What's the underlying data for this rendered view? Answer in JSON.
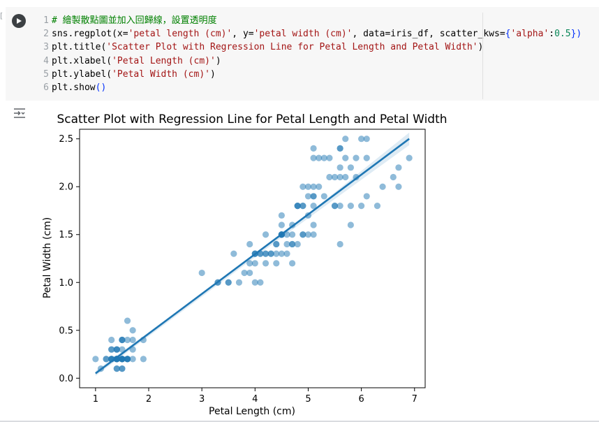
{
  "notebook": {
    "cell": {
      "lines": [
        {
          "num": "1",
          "parts": [
            {
              "t": "# 繪製散點圖並加入回歸線，設置透明度",
              "c": "c-com"
            }
          ]
        },
        {
          "num": "2",
          "parts": [
            {
              "t": "sns.regplot(x=",
              "c": "c-def"
            },
            {
              "t": "'petal length (cm)'",
              "c": "c-str"
            },
            {
              "t": ", y=",
              "c": "c-def"
            },
            {
              "t": "'petal width (cm)'",
              "c": "c-str"
            },
            {
              "t": ", data=iris_df, scatter_kws=",
              "c": "c-def"
            },
            {
              "t": "{",
              "c": "c-punc"
            },
            {
              "t": "'alpha'",
              "c": "c-str"
            },
            {
              "t": ":",
              "c": "c-def"
            },
            {
              "t": "0.5",
              "c": "c-num"
            },
            {
              "t": "})",
              "c": "c-punc"
            }
          ]
        },
        {
          "num": "3",
          "parts": [
            {
              "t": "plt.title(",
              "c": "c-def"
            },
            {
              "t": "'Scatter Plot with Regression Line for Petal Length and Petal Width'",
              "c": "c-str"
            },
            {
              "t": ")",
              "c": "c-def"
            }
          ]
        },
        {
          "num": "4",
          "parts": [
            {
              "t": "plt.xlabel(",
              "c": "c-def"
            },
            {
              "t": "'Petal Length (cm)'",
              "c": "c-str"
            },
            {
              "t": ")",
              "c": "c-def"
            }
          ]
        },
        {
          "num": "5",
          "parts": [
            {
              "t": "plt.ylabel(",
              "c": "c-def"
            },
            {
              "t": "'Petal Width (cm)'",
              "c": "c-str"
            },
            {
              "t": ")",
              "c": "c-def"
            }
          ]
        },
        {
          "num": "6",
          "parts": [
            {
              "t": "plt.show",
              "c": "c-def"
            },
            {
              "t": "()",
              "c": "c-punc"
            }
          ]
        }
      ]
    },
    "icons": {
      "run": "play-icon",
      "output": "output-toggle-icon"
    }
  },
  "chart_data": {
    "type": "scatter",
    "title": "Scatter Plot with Regression Line for Petal Length and Petal Width",
    "xlabel": "Petal Length (cm)",
    "ylabel": "Petal Width (cm)",
    "xlim": [
      0.7,
      7.2
    ],
    "ylim": [
      -0.1,
      2.6
    ],
    "xticks": [
      "1",
      "2",
      "3",
      "4",
      "5",
      "6",
      "7"
    ],
    "yticks": [
      "0.0",
      "0.5",
      "1.0",
      "1.5",
      "2.0",
      "2.5"
    ],
    "grid": false,
    "point_color": "#1f77b4",
    "point_alpha": 0.5,
    "regression": {
      "x": [
        1.0,
        6.9
      ],
      "y": [
        0.05,
        2.5
      ],
      "color": "#1f77b4"
    },
    "points": [
      [
        1.4,
        0.2
      ],
      [
        1.4,
        0.2
      ],
      [
        1.3,
        0.2
      ],
      [
        1.5,
        0.2
      ],
      [
        1.4,
        0.2
      ],
      [
        1.7,
        0.4
      ],
      [
        1.4,
        0.3
      ],
      [
        1.5,
        0.2
      ],
      [
        1.4,
        0.2
      ],
      [
        1.5,
        0.1
      ],
      [
        1.5,
        0.2
      ],
      [
        1.6,
        0.2
      ],
      [
        1.4,
        0.1
      ],
      [
        1.1,
        0.1
      ],
      [
        1.2,
        0.2
      ],
      [
        1.5,
        0.4
      ],
      [
        1.3,
        0.4
      ],
      [
        1.4,
        0.3
      ],
      [
        1.7,
        0.3
      ],
      [
        1.5,
        0.3
      ],
      [
        1.7,
        0.2
      ],
      [
        1.5,
        0.4
      ],
      [
        1.0,
        0.2
      ],
      [
        1.7,
        0.5
      ],
      [
        1.9,
        0.2
      ],
      [
        1.6,
        0.2
      ],
      [
        1.6,
        0.4
      ],
      [
        1.5,
        0.2
      ],
      [
        1.4,
        0.2
      ],
      [
        1.6,
        0.2
      ],
      [
        1.6,
        0.2
      ],
      [
        1.5,
        0.4
      ],
      [
        1.5,
        0.1
      ],
      [
        1.4,
        0.2
      ],
      [
        1.5,
        0.2
      ],
      [
        1.2,
        0.2
      ],
      [
        1.3,
        0.2
      ],
      [
        1.4,
        0.1
      ],
      [
        1.3,
        0.2
      ],
      [
        1.5,
        0.2
      ],
      [
        1.3,
        0.3
      ],
      [
        1.3,
        0.3
      ],
      [
        1.3,
        0.2
      ],
      [
        1.6,
        0.6
      ],
      [
        1.9,
        0.4
      ],
      [
        1.4,
        0.3
      ],
      [
        1.6,
        0.2
      ],
      [
        1.4,
        0.2
      ],
      [
        1.5,
        0.2
      ],
      [
        1.4,
        0.2
      ],
      [
        4.7,
        1.4
      ],
      [
        4.5,
        1.5
      ],
      [
        4.9,
        1.5
      ],
      [
        4.0,
        1.3
      ],
      [
        4.6,
        1.5
      ],
      [
        4.5,
        1.3
      ],
      [
        4.7,
        1.6
      ],
      [
        3.3,
        1.0
      ],
      [
        4.6,
        1.3
      ],
      [
        3.9,
        1.4
      ],
      [
        3.5,
        1.0
      ],
      [
        4.2,
        1.5
      ],
      [
        4.0,
        1.0
      ],
      [
        4.7,
        1.4
      ],
      [
        3.6,
        1.3
      ],
      [
        4.4,
        1.4
      ],
      [
        4.5,
        1.5
      ],
      [
        4.1,
        1.0
      ],
      [
        4.5,
        1.5
      ],
      [
        3.9,
        1.1
      ],
      [
        4.8,
        1.8
      ],
      [
        4.0,
        1.3
      ],
      [
        4.9,
        1.5
      ],
      [
        4.7,
        1.2
      ],
      [
        4.3,
        1.3
      ],
      [
        4.4,
        1.4
      ],
      [
        4.8,
        1.4
      ],
      [
        5.0,
        1.7
      ],
      [
        4.5,
        1.5
      ],
      [
        3.5,
        1.0
      ],
      [
        3.8,
        1.1
      ],
      [
        3.7,
        1.0
      ],
      [
        3.9,
        1.2
      ],
      [
        5.1,
        1.6
      ],
      [
        4.5,
        1.5
      ],
      [
        4.5,
        1.6
      ],
      [
        4.7,
        1.5
      ],
      [
        4.4,
        1.3
      ],
      [
        4.1,
        1.3
      ],
      [
        4.0,
        1.3
      ],
      [
        4.4,
        1.2
      ],
      [
        4.6,
        1.4
      ],
      [
        4.0,
        1.2
      ],
      [
        3.3,
        1.0
      ],
      [
        4.2,
        1.3
      ],
      [
        4.2,
        1.2
      ],
      [
        4.2,
        1.3
      ],
      [
        4.3,
        1.3
      ],
      [
        3.0,
        1.1
      ],
      [
        4.1,
        1.3
      ],
      [
        6.0,
        2.5
      ],
      [
        5.1,
        1.9
      ],
      [
        5.9,
        2.1
      ],
      [
        5.6,
        1.8
      ],
      [
        5.8,
        2.2
      ],
      [
        6.6,
        2.1
      ],
      [
        4.5,
        1.7
      ],
      [
        6.3,
        1.8
      ],
      [
        5.8,
        1.8
      ],
      [
        6.1,
        2.5
      ],
      [
        5.1,
        2.0
      ],
      [
        5.3,
        1.9
      ],
      [
        5.5,
        2.1
      ],
      [
        5.0,
        2.0
      ],
      [
        5.1,
        2.4
      ],
      [
        5.3,
        2.3
      ],
      [
        5.5,
        1.8
      ],
      [
        6.7,
        2.2
      ],
      [
        6.9,
        2.3
      ],
      [
        5.0,
        1.5
      ],
      [
        5.7,
        2.3
      ],
      [
        4.9,
        2.0
      ],
      [
        6.7,
        2.0
      ],
      [
        4.9,
        1.8
      ],
      [
        5.7,
        2.1
      ],
      [
        6.0,
        1.8
      ],
      [
        4.8,
        1.8
      ],
      [
        4.9,
        1.8
      ],
      [
        5.6,
        2.1
      ],
      [
        5.8,
        1.6
      ],
      [
        6.1,
        1.9
      ],
      [
        6.4,
        2.0
      ],
      [
        5.6,
        2.2
      ],
      [
        5.1,
        1.5
      ],
      [
        5.6,
        1.4
      ],
      [
        6.1,
        2.3
      ],
      [
        5.6,
        2.4
      ],
      [
        5.5,
        1.8
      ],
      [
        4.8,
        1.8
      ],
      [
        5.4,
        2.1
      ],
      [
        5.6,
        2.4
      ],
      [
        5.1,
        2.3
      ],
      [
        5.1,
        1.9
      ],
      [
        5.9,
        2.3
      ],
      [
        5.7,
        2.5
      ],
      [
        5.2,
        2.3
      ],
      [
        5.0,
        1.9
      ],
      [
        5.2,
        2.0
      ],
      [
        5.4,
        2.3
      ],
      [
        5.1,
        1.8
      ]
    ]
  }
}
